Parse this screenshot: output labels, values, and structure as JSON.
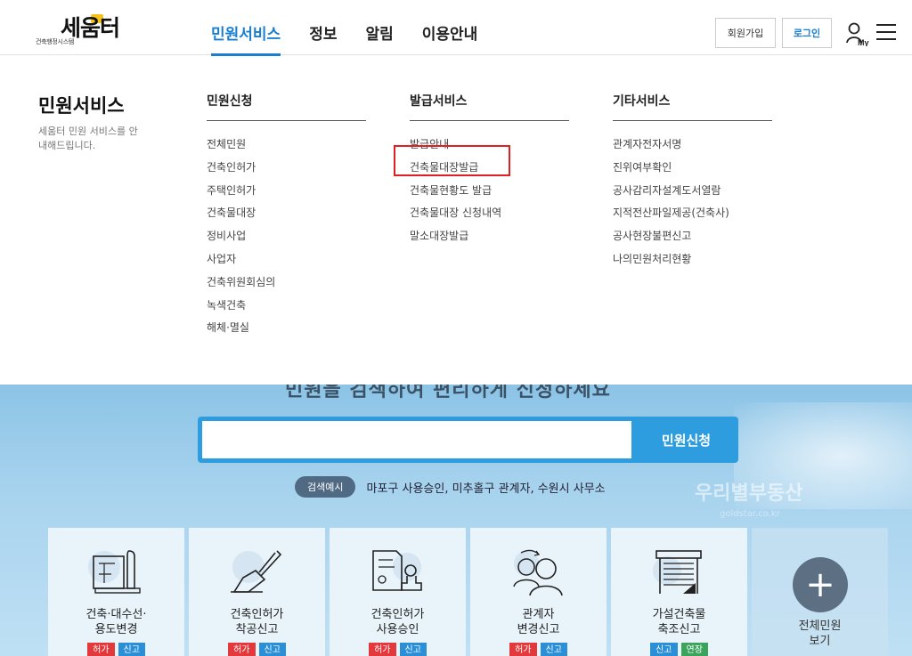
{
  "header": {
    "logo_sub": "건축행정시스템",
    "logo_main": "세움터",
    "nav": [
      {
        "label": "민원서비스"
      },
      {
        "label": "정보"
      },
      {
        "label": "알림"
      },
      {
        "label": "이용안내"
      }
    ],
    "join_label": "회원가입",
    "login_label": "로그인",
    "my_label": "My"
  },
  "mega": {
    "title": "민원서비스",
    "desc": "세움터 민원 서비스를 안내해드립니다.",
    "columns": [
      {
        "head": "민원신청",
        "items": [
          "전체민원",
          "건축인허가",
          "주택인허가",
          "건축물대장",
          "정비사업",
          "사업자",
          "건축위원회심의",
          "녹색건축",
          "해체·멸실"
        ]
      },
      {
        "head": "발급서비스",
        "items": [
          "발급안내",
          "건축물대장발급",
          "건축물현황도 발급",
          "건축물대장 신청내역",
          "말소대장발급"
        ]
      },
      {
        "head": "기타서비스",
        "items": [
          "관계자전자서명",
          "진위여부확인",
          "공사감리자설계도서열람",
          "지적전산파일제공(건축사)",
          "공사현장불편신고",
          "나의민원처리현황"
        ]
      }
    ]
  },
  "search": {
    "hidden_heading": "민원을 검색하여 편리하게 신청하세요",
    "placeholder": "",
    "button_label": "민원신청",
    "example_label": "검색예시",
    "example_text": "마포구 사용승인, 미추홀구 관계자, 수원시 사무소"
  },
  "watermark": {
    "main": "우리별부동산",
    "sub": "goldstar.co.kr"
  },
  "cards": [
    {
      "title": "건축·대수선·\n용도변경",
      "tags": [
        {
          "label": "허가",
          "color": "red"
        },
        {
          "label": "신고",
          "color": "blue"
        }
      ],
      "icon": "blueprint-icon"
    },
    {
      "title": "건축인허가\n착공신고",
      "tags": [
        {
          "label": "허가",
          "color": "red"
        },
        {
          "label": "신고",
          "color": "blue"
        }
      ],
      "icon": "shovel-icon"
    },
    {
      "title": "건축인허가\n사용승인",
      "tags": [
        {
          "label": "허가",
          "color": "red"
        },
        {
          "label": "신고",
          "color": "blue"
        }
      ],
      "icon": "stamp-document-icon"
    },
    {
      "title": "관계자\n변경신고",
      "tags": [
        {
          "label": "허가",
          "color": "red"
        },
        {
          "label": "신고",
          "color": "blue"
        }
      ],
      "icon": "people-swap-icon"
    },
    {
      "title": "가설건축물\n축조신고",
      "tags": [
        {
          "label": "신고",
          "color": "blue"
        },
        {
          "label": "연장",
          "color": "green"
        }
      ],
      "icon": "shutter-building-icon"
    }
  ],
  "all_card": {
    "title": "전체민원\n보기",
    "icon": "plus-icon"
  }
}
